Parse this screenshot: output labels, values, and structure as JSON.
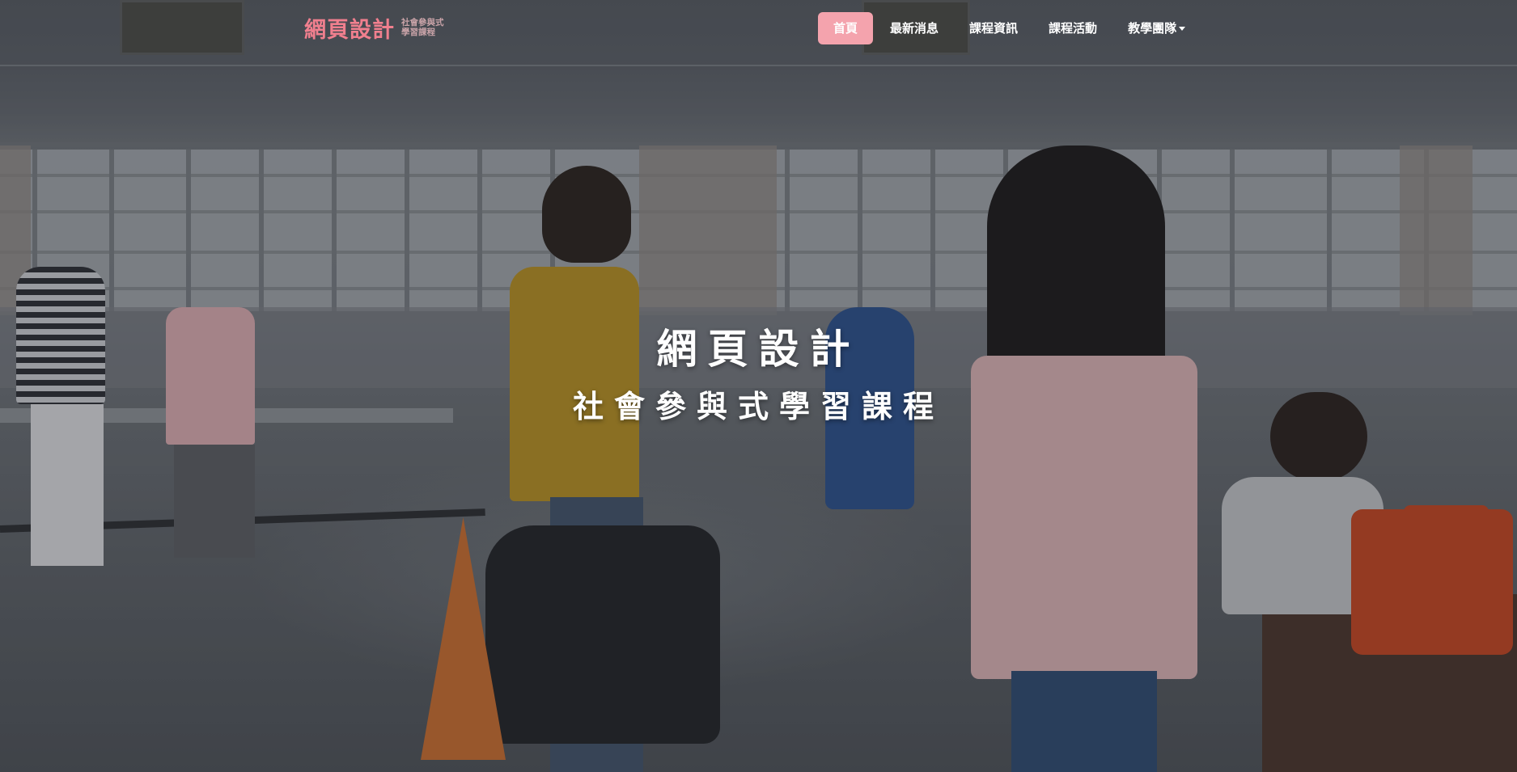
{
  "brand": {
    "title": "網頁設計",
    "subtitle_line1": "社會參與式",
    "subtitle_line2": "學習課程"
  },
  "nav": {
    "items": [
      {
        "label": "首頁",
        "active": true
      },
      {
        "label": "最新消息",
        "active": false
      },
      {
        "label": "課程資訊",
        "active": false
      },
      {
        "label": "課程活動",
        "active": false
      },
      {
        "label": "教學團隊",
        "active": false,
        "dropdown": true
      }
    ]
  },
  "hero": {
    "title": "網頁設計",
    "subtitle": "社會參與式學習課程"
  },
  "colors": {
    "brand_pink": "#f07f8e",
    "active_nav_bg": "#f4a3ad",
    "text_white": "#ffffff"
  },
  "icons": {
    "dropdown": "caret-down-icon"
  }
}
